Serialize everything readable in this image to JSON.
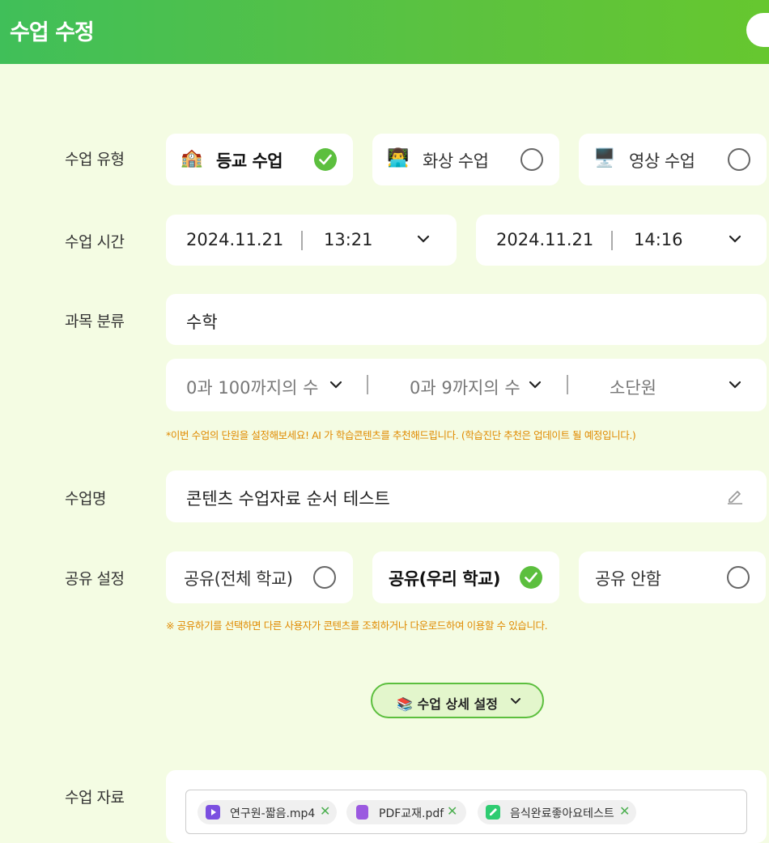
{
  "header": {
    "title": "수업 수정"
  },
  "labels": {
    "class_type": "수업 유형",
    "class_time": "수업 시간",
    "subject": "과목 분류",
    "class_name": "수업명",
    "share": "공유 설정",
    "materials": "수업 자료"
  },
  "class_type": {
    "options": [
      {
        "emoji": "🏫",
        "label": "등교 수업",
        "selected": true
      },
      {
        "emoji": "👨‍💻",
        "label": "화상 수업",
        "selected": false
      },
      {
        "emoji": "🖥️",
        "label": "영상 수업",
        "selected": false
      }
    ]
  },
  "class_time": {
    "start": {
      "date": "2024.11.21",
      "time": "13:21"
    },
    "end": {
      "date": "2024.11.21",
      "time": "14:16"
    }
  },
  "subject": {
    "value": "수학",
    "unit1": "0과 100까지의 수",
    "unit2": "0과 9까지의 수",
    "unit3": "소단원",
    "note": "*이번 수업의 단원을 설정해보세요! AI 가 학습콘텐츠를 추천해드립니다. (학습진단 추천은 업데이트 될 예정입니다.)"
  },
  "class_name": {
    "value": "콘텐츠 수업자료 순서 테스트"
  },
  "share": {
    "options": [
      {
        "label": "공유(전체 학교)",
        "selected": false
      },
      {
        "label": "공유(우리 학교)",
        "selected": true
      },
      {
        "label": "공유 안함",
        "selected": false
      }
    ],
    "note": "※ 공유하기를 선택하면 다른 사용자가 콘텐츠를 조회하거나 다운로드하여 이용할 수 있습니다."
  },
  "detail_button": {
    "label": "📚 수업 상세 설정"
  },
  "materials": {
    "files": [
      {
        "name": "연구원-짧음.mp4",
        "icon": "video-icon",
        "color": "#7b4fe0"
      },
      {
        "name": "PDF교재.pdf",
        "icon": "book-icon",
        "color": "#9b59e0"
      },
      {
        "name": "음식완료좋아요테스트",
        "icon": "note-icon",
        "color": "#2ecc71"
      }
    ]
  },
  "colors": {
    "accent": "#5cbf3e",
    "background": "#f4fce3",
    "note": "#e08a00"
  }
}
